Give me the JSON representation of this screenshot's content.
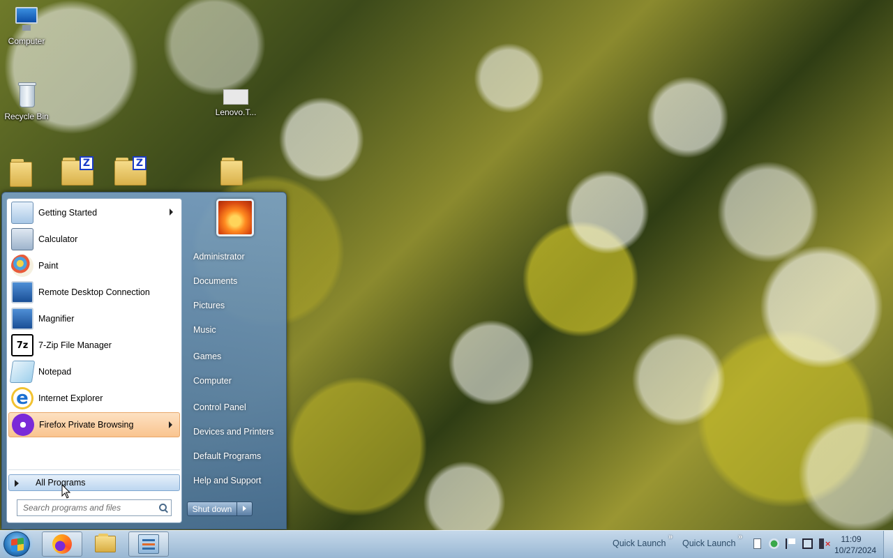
{
  "desktop": {
    "icons": [
      {
        "label": "Computer"
      },
      {
        "label": "Recycle Bin"
      },
      {
        "label": "Lenovo.T..."
      }
    ],
    "folder_badge": "Z"
  },
  "start_menu": {
    "programs": [
      {
        "label": "Getting Started",
        "icon": "getting-started-icon",
        "has_submenu": true
      },
      {
        "label": "Calculator",
        "icon": "calculator-icon"
      },
      {
        "label": "Paint",
        "icon": "paint-icon"
      },
      {
        "label": "Remote Desktop Connection",
        "icon": "remote-desktop-icon"
      },
      {
        "label": "Magnifier",
        "icon": "magnifier-icon"
      },
      {
        "label": "7-Zip File Manager",
        "icon": "7zip-icon",
        "badge": "7z"
      },
      {
        "label": "Notepad",
        "icon": "notepad-icon"
      },
      {
        "label": "Internet Explorer",
        "icon": "internet-explorer-icon",
        "badge": "e"
      },
      {
        "label": "Firefox Private Browsing",
        "icon": "firefox-private-icon",
        "has_submenu": true,
        "highlighted": true
      }
    ],
    "all_programs": "All Programs",
    "search_placeholder": "Search programs and files",
    "right_links": [
      "Administrator",
      "Documents",
      "Pictures",
      "Music",
      "Games",
      "Computer",
      "Control Panel",
      "Devices and Printers",
      "Default Programs",
      "Help and Support"
    ],
    "shutdown_label": "Shut down"
  },
  "taskbar": {
    "quick_launch": [
      "Quick Launch",
      "Quick Launch"
    ],
    "quick_launch_chevron": "»",
    "clock_time": "11:09",
    "clock_date": "10/27/2024"
  }
}
